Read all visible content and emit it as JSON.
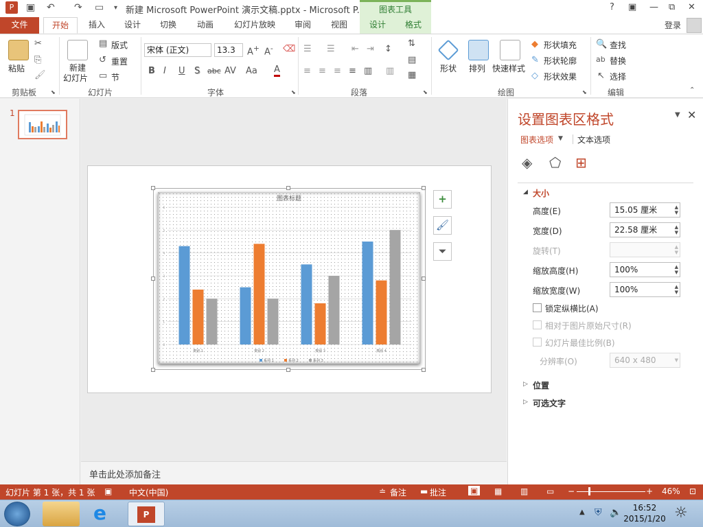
{
  "title_bar": {
    "title": "新建 Microsoft PowerPoint 演示文稿.pptx - Microsoft P...",
    "contextual_header": "图表工具",
    "window_buttons": [
      "?",
      "▣",
      "—",
      "⧉",
      "✕"
    ]
  },
  "tabs": {
    "file": "文件",
    "items": [
      "开始",
      "插入",
      "设计",
      "切换",
      "动画",
      "幻灯片放映",
      "审阅",
      "视图"
    ],
    "contextual": [
      "设计",
      "格式"
    ],
    "login": "登录"
  },
  "ribbon": {
    "clipboard": {
      "label": "剪贴板",
      "paste": "粘贴"
    },
    "slides": {
      "label": "幻灯片",
      "new_slide_line1": "新建",
      "new_slide_line2": "幻灯片",
      "layout": "版式",
      "reset": "重置",
      "section": "节"
    },
    "font": {
      "label": "字体",
      "font_name": "宋体 (正文)",
      "font_size": "13.3",
      "format_buttons": [
        "B",
        "I",
        "U",
        "S",
        "abc",
        "AV",
        "Aa",
        "A"
      ]
    },
    "paragraph": {
      "label": "段落"
    },
    "drawing": {
      "label": "绘图",
      "shapes": "形状",
      "arrange": "排列",
      "quick_styles": "快速样式",
      "shape_fill": "形状填充",
      "shape_outline": "形状轮廓",
      "shape_effects": "形状效果"
    },
    "editing": {
      "label": "编辑",
      "find": "查找",
      "replace": "替换",
      "select": "选择"
    }
  },
  "thumbnail": {
    "slide_number": "1"
  },
  "chart_data": {
    "type": "bar",
    "title": "图表标题",
    "categories": [
      "类别 1",
      "类别 2",
      "类别 3",
      "类别 4"
    ],
    "series": [
      {
        "name": "系列 1",
        "values": [
          4.3,
          2.5,
          3.5,
          4.5
        ],
        "color": "#5b9bd5"
      },
      {
        "name": "系列 2",
        "values": [
          2.4,
          4.4,
          1.8,
          2.8
        ],
        "color": "#ed7d31"
      },
      {
        "name": "系列 3",
        "values": [
          2.0,
          2.0,
          3.0,
          5.0
        ],
        "color": "#a5a5a5"
      }
    ],
    "ylim": [
      0,
      6
    ],
    "yticks": [
      "0",
      "1",
      "2",
      "3",
      "4",
      "5",
      "6"
    ],
    "grid": true,
    "legend": "bottom"
  },
  "notes": {
    "placeholder": "单击此处添加备注"
  },
  "format_pane": {
    "title": "设置图表区格式",
    "tab_chart_options": "图表选项",
    "tab_text_options": "文本选项",
    "size_section": "大小",
    "height_label": "高度(E)",
    "height_value": "15.05 厘米",
    "width_label": "宽度(D)",
    "width_value": "22.58 厘米",
    "rotation_label": "旋转(T)",
    "rotation_value": "",
    "scale_height_label": "缩放高度(H)",
    "scale_height_value": "100%",
    "scale_width_label": "缩放宽度(W)",
    "scale_width_value": "100%",
    "lock_aspect_label": "锁定纵横比(A)",
    "relative_original_label": "相对于图片原始尺寸(R)",
    "best_scale_label": "幻灯片最佳比例(B)",
    "resolution_label": "分辨率(O)",
    "resolution_value": "640 x 480",
    "position_section": "位置",
    "alt_text_section": "可选文字"
  },
  "status_bar": {
    "slide_info": "幻灯片 第 1 张，共 1 张",
    "language": "中文(中国)",
    "notes": "备注",
    "comments": "批注",
    "zoom": "46%"
  },
  "taskbar": {
    "time": "16:52",
    "date": "2015/1/20"
  },
  "colors": {
    "accent": "#c0462a",
    "chart_tools": "#dff1d7"
  }
}
